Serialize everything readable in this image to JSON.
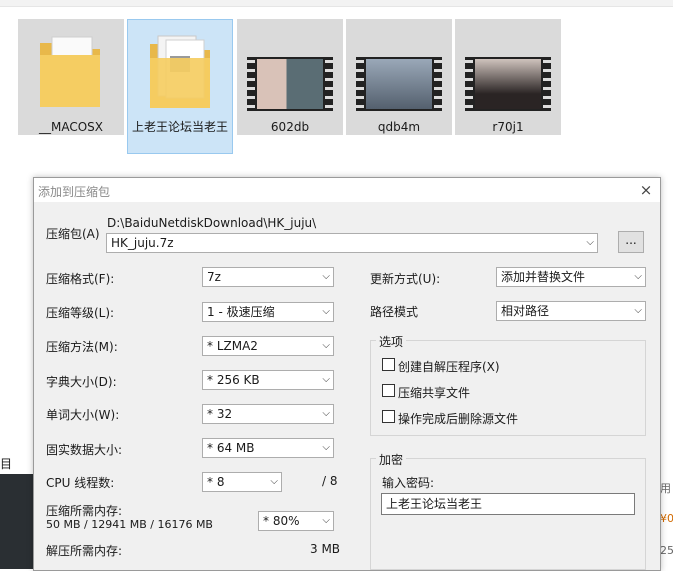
{
  "explorer": {
    "items": [
      {
        "name": "__MACOSX",
        "kind": "folder"
      },
      {
        "name": "上老王论坛当老王",
        "kind": "folder",
        "selected": true
      },
      {
        "name": "602db",
        "kind": "video"
      },
      {
        "name": "qdb4m",
        "kind": "video"
      },
      {
        "name": "r70j1",
        "kind": "video"
      }
    ],
    "left_cut_text": "目",
    "right_cut_texts": [
      "用",
      "¥0",
      "25"
    ]
  },
  "dialog": {
    "title": "添加到压缩包",
    "close_label": "×",
    "archive": {
      "label": "压缩包(A)",
      "path": "D:\\BaiduNetdiskDownload\\HK_juju\\",
      "filename": "HK_juju.7z",
      "browse_label": "..."
    },
    "left": {
      "format": {
        "label": "压缩格式(F):",
        "value": "7z"
      },
      "level": {
        "label": "压缩等级(L):",
        "value": "1 - 极速压缩"
      },
      "method": {
        "label": "压缩方法(M):",
        "value": "* LZMA2"
      },
      "dict": {
        "label": "字典大小(D):",
        "value": "* 256 KB"
      },
      "word": {
        "label": "单词大小(W):",
        "value": "* 32"
      },
      "solid": {
        "label": "固实数据大小:",
        "value": "* 64 MB"
      },
      "threads": {
        "label": "CPU 线程数:",
        "value": "* 8",
        "max": "/ 8"
      },
      "mem_compress": {
        "label": "压缩所需内存:",
        "detail": "50 MB / 12941 MB / 16176 MB",
        "value": "* 80%"
      },
      "mem_decompress": {
        "label": "解压所需内存:",
        "value": "3 MB"
      }
    },
    "right": {
      "update": {
        "label": "更新方式(U):",
        "value": "添加并替换文件"
      },
      "path_mode": {
        "label": "路径模式",
        "value": "相对路径"
      },
      "options": {
        "title": "选项",
        "items": [
          "创建自解压程序(X)",
          "压缩共享文件",
          "操作完成后删除源文件"
        ]
      },
      "encrypt": {
        "title": "加密",
        "password_label": "输入密码:",
        "password_value": "上老王论坛当老王"
      }
    }
  }
}
